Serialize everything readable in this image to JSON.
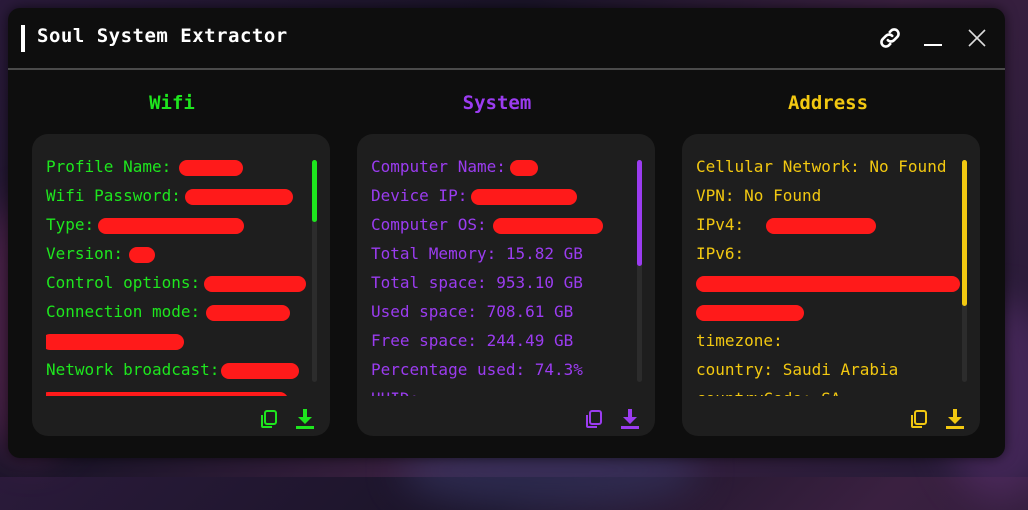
{
  "window": {
    "title": "Soul System Extractor"
  },
  "colors": {
    "wifi": "#1ee61e",
    "system": "#9b3cf0",
    "address": "#f2c811",
    "redaction": "#ff1a1a"
  },
  "icons": {
    "link": "link-icon",
    "minimize": "minimize-icon",
    "close": "close-icon",
    "copy": "copy-icon",
    "download": "download-icon"
  },
  "wifi": {
    "title": "Wifi",
    "lines": [
      "Profile Name:",
      "Wifi Password:",
      "Type:",
      "Version:",
      "Control options:",
      "Connection mode:",
      "",
      "Network broadcast:",
      ""
    ]
  },
  "system": {
    "title": "System",
    "lines": [
      "Computer Name:",
      "Device IP:",
      "Computer OS:",
      "Total Memory: 15.82 GB",
      "Total space: 953.10 GB",
      "Used space: 708.61 GB",
      "Free space: 244.49 GB",
      "Percentage used: 74.3%",
      "UUID:"
    ]
  },
  "address": {
    "title": "Address",
    "lines": [
      "Cellular Network: No Found",
      "VPN: No Found",
      "IPv4:",
      "IPv6:",
      "",
      "",
      "timezone:",
      "country: Saudi Arabia",
      "countryCode: SA"
    ]
  }
}
